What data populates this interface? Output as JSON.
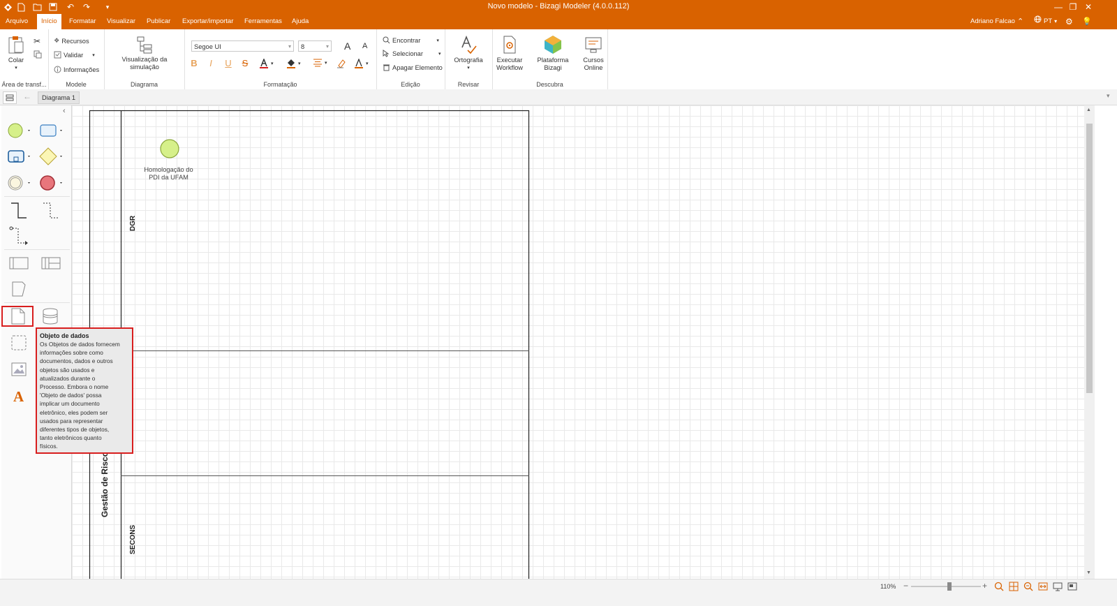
{
  "window": {
    "title": "Novo modelo - Bizagi Modeler (4.0.0.112)",
    "controls": [
      "—",
      "❐",
      "✕"
    ]
  },
  "quick_access": [
    "app-logo-icon",
    "new-icon",
    "open-icon",
    "save-icon",
    "undo-icon",
    "redo-icon",
    "customize-icon"
  ],
  "menu": {
    "tabs": [
      "Arquivo",
      "Início",
      "Formatar",
      "Visualizar",
      "Publicar",
      "Exportar/importar",
      "Ferramentas",
      "Ajuda"
    ],
    "active_tab": "Início",
    "user": "Adriano Falcao",
    "language": "PT"
  },
  "ribbon": {
    "clipboard": {
      "paste": "Colar",
      "group": "Área de transf..."
    },
    "model": {
      "resources": "Recursos",
      "validate": "Validar",
      "info": "Informações",
      "group": "Modele"
    },
    "diagram": {
      "simulation": "Visualização da simulação",
      "group": "Diagrama"
    },
    "format": {
      "font": "Segoe UI",
      "size": "8",
      "grow": "A",
      "shrink": "A",
      "bold": "B",
      "italic": "I",
      "underline": "U",
      "strike": "S",
      "group": "Formatação"
    },
    "edit": {
      "find": "Encontrar",
      "select": "Selecionar",
      "delete": "Apagar Elemento",
      "group": "Edição"
    },
    "review": {
      "spelling": "Ortografia",
      "group": "Revisar"
    },
    "discover": {
      "workflow": [
        "Executar",
        "Workflow"
      ],
      "platform": "Plataforma Bizagi",
      "courses": [
        "Cursos",
        "Online"
      ],
      "group": "Descubra"
    }
  },
  "document": {
    "tab": "Diagrama 1"
  },
  "diagram": {
    "start_event": [
      "Homologação do",
      "PDI da UFAM"
    ],
    "lanes": {
      "pool": "Gestão de Risco",
      "lane1": "DGR",
      "lane3": "SECONS"
    }
  },
  "tooltip": {
    "title": "Objeto de dados",
    "lines": [
      "Os Objetos de dados fornecem",
      "informações sobre como",
      "documentos, dados e outros",
      "objetos são usados e",
      "atualizados durante o",
      "Processo. Embora o nome",
      "'Objeto de dados' possa",
      "implicar um documento",
      "eletrônico, eles podem ser",
      "usados para representar",
      "diferentes tipos de objetos,",
      "tanto eletrônicos quanto",
      "físicos."
    ]
  },
  "status": {
    "zoom": "110%",
    "zoom_fraction": 0.55
  },
  "colors": {
    "brand": "#d96200",
    "highlight": "#d81e1e",
    "start_event": "#d6f08a",
    "end_event": "#e8767c"
  }
}
